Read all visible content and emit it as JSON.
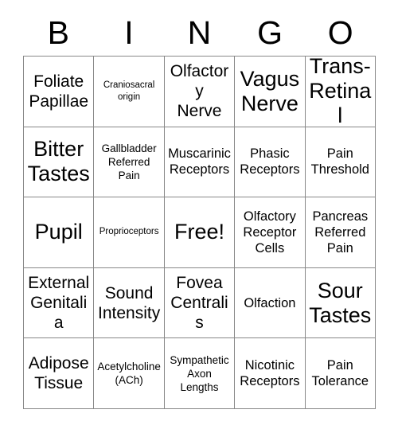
{
  "card": {
    "header": {
      "letters": [
        "B",
        "I",
        "N",
        "G",
        "O"
      ]
    },
    "cells": [
      {
        "text": "Foliate\nPapillae",
        "size": "lg"
      },
      {
        "text": "Craniosacral\norigin",
        "size": "xs"
      },
      {
        "text": "Olfactory\nNerve",
        "size": "lg"
      },
      {
        "text": "Vagus\nNerve",
        "size": "xl"
      },
      {
        "text": "Trans-\nRetinal",
        "size": "xl"
      },
      {
        "text": "Bitter\nTastes",
        "size": "xl"
      },
      {
        "text": "Gallbladder\nReferred\nPain",
        "size": "sm"
      },
      {
        "text": "Muscarinic\nReceptors",
        "size": "md"
      },
      {
        "text": "Phasic\nReceptors",
        "size": "md"
      },
      {
        "text": "Pain\nThreshold",
        "size": "md"
      },
      {
        "text": "Pupil",
        "size": "xl"
      },
      {
        "text": "Proprioceptors",
        "size": "xs"
      },
      {
        "text": "Free!",
        "size": "xl"
      },
      {
        "text": "Olfactory\nReceptor\nCells",
        "size": "md"
      },
      {
        "text": "Pancreas\nReferred\nPain",
        "size": "md"
      },
      {
        "text": "External\nGenitalia",
        "size": "lg"
      },
      {
        "text": "Sound\nIntensity",
        "size": "lg"
      },
      {
        "text": "Fovea\nCentralis",
        "size": "lg"
      },
      {
        "text": "Olfaction",
        "size": "md"
      },
      {
        "text": "Sour\nTastes",
        "size": "xl"
      },
      {
        "text": "Adipose\nTissue",
        "size": "lg"
      },
      {
        "text": "Acetylcholine\n(ACh)",
        "size": "sm"
      },
      {
        "text": "Sympathetic\nAxon\nLengths",
        "size": "sm"
      },
      {
        "text": "Nicotinic\nReceptors",
        "size": "md"
      },
      {
        "text": "Pain\nTolerance",
        "size": "md"
      }
    ],
    "colors": {
      "background": "#ffffff",
      "text": "#000000",
      "border": "#888888"
    }
  }
}
